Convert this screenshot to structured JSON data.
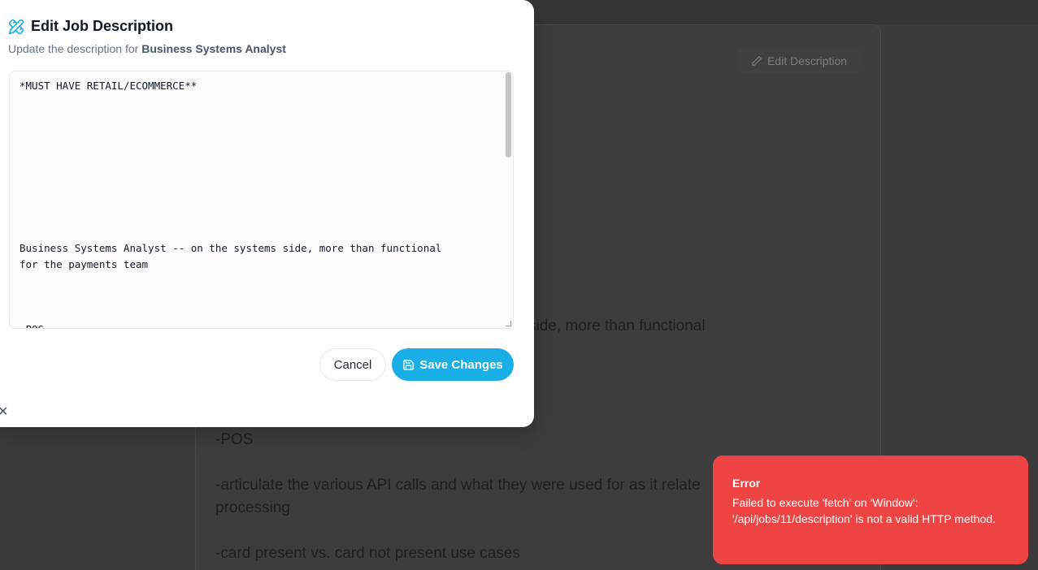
{
  "background": {
    "edit_button_label": "Edit Description",
    "lines": [
      "side, more than functional",
      "-POS",
      "-articulate the various API calls and what they were used for as it relate",
      "processing",
      "-card present vs. card not present use cases"
    ]
  },
  "modal": {
    "title": "Edit Job Description",
    "subtitle_prefix": "Update the description for ",
    "job_title": "Business Systems Analyst",
    "description_text": "*MUST HAVE RETAIL/ECOMMERCE**\n\n\n\n\n\n\n\n\n\nBusiness Systems Analyst -- on the systems side, more than functional\nfor the payments team\n\n\n\n-POS",
    "cancel_label": "Cancel",
    "save_label": "Save Changes",
    "close_glyph": "✕",
    "icons": {
      "title": "pencil-ruler-icon",
      "save": "save-icon",
      "close": "close-icon"
    }
  },
  "toast": {
    "title": "Error",
    "message": "Failed to execute 'fetch' on 'Window': '/api/jobs/11/description' is not a valid HTTP method."
  },
  "colors": {
    "primary": "#1aaee6",
    "error": "#ef4444",
    "overlay": "#3b3b3b"
  }
}
